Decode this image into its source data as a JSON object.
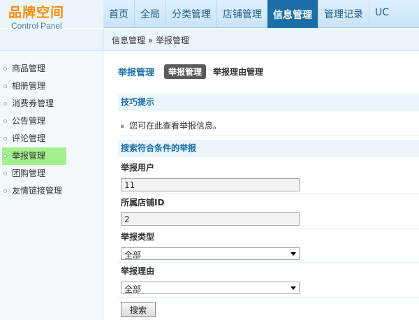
{
  "logo": {
    "title": "品牌空间",
    "subtitle": "Control Panel"
  },
  "nav": {
    "items": [
      {
        "label": "首页"
      },
      {
        "label": "全局"
      },
      {
        "label": "分类管理"
      },
      {
        "label": "店铺管理"
      },
      {
        "label": "信息管理",
        "active": true
      },
      {
        "label": "管理记录"
      },
      {
        "label": "UC"
      }
    ]
  },
  "sidebar": {
    "items": [
      {
        "label": "商品管理"
      },
      {
        "label": "相册管理"
      },
      {
        "label": "消费券管理"
      },
      {
        "label": "公告管理"
      },
      {
        "label": "评论管理"
      },
      {
        "label": "举报管理",
        "active": true
      },
      {
        "label": "团购管理"
      },
      {
        "label": "友情链接管理"
      }
    ]
  },
  "breadcrumb": {
    "path": "信息管理 » 举报管理"
  },
  "page": {
    "title": "举报管理",
    "tabs": [
      {
        "label": "举报管理",
        "active": true
      },
      {
        "label": "举报理由管理"
      }
    ]
  },
  "tips": {
    "heading": "技巧提示",
    "text": "您可在此查看举报信息。"
  },
  "search": {
    "heading": "搜索符合条件的举报",
    "user_label": "举报用户",
    "user_value": "11",
    "shop_label": "所属店铺ID",
    "shop_value": "2",
    "type_label": "举报类型",
    "type_value": "全部",
    "reason_label": "举报理由",
    "reason_value": "全部",
    "button_label": "搜索"
  },
  "colors": {
    "accent": "#1a6fab",
    "nav_active": "#1c6ea7",
    "sidebar_active": "#a4f08f",
    "logo": "#ff8a00"
  }
}
